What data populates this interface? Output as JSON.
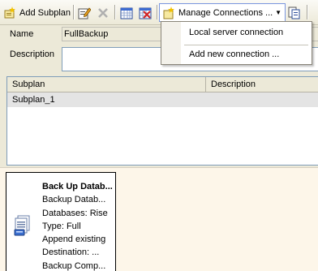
{
  "toolbar": {
    "add_subplan": "Add Subplan",
    "manage_connections": "Manage Connections ..."
  },
  "form": {
    "name_label": "Name",
    "name_value": "FullBackup",
    "description_label": "Description",
    "description_value": ""
  },
  "connections_menu": {
    "items": [
      "Local server connection",
      "Add new connection ..."
    ]
  },
  "subplans": {
    "columns": [
      "Subplan",
      "Description"
    ],
    "rows": [
      {
        "subplan": "Subplan_1",
        "description": ""
      }
    ]
  },
  "task": {
    "title": "Back Up Datab...",
    "lines": [
      "Backup Datab...",
      "Databases: Rise",
      "Type: Full",
      "Append existing",
      "Destination: ...",
      "Backup Comp..."
    ]
  },
  "icons": {
    "add_subplan": "add-subplan-icon",
    "properties": "properties-icon",
    "delete": "delete-icon",
    "schedule": "schedule-icon",
    "remove_schedule": "remove-schedule-icon",
    "manage_connections": "manage-connections-icon",
    "report": "report-icon",
    "backup_task": "backup-task-icon"
  },
  "colors": {
    "menu_border": "#7a96df",
    "designer_bg": "#fdf6e9",
    "selected_row": "#e4e4e4"
  }
}
